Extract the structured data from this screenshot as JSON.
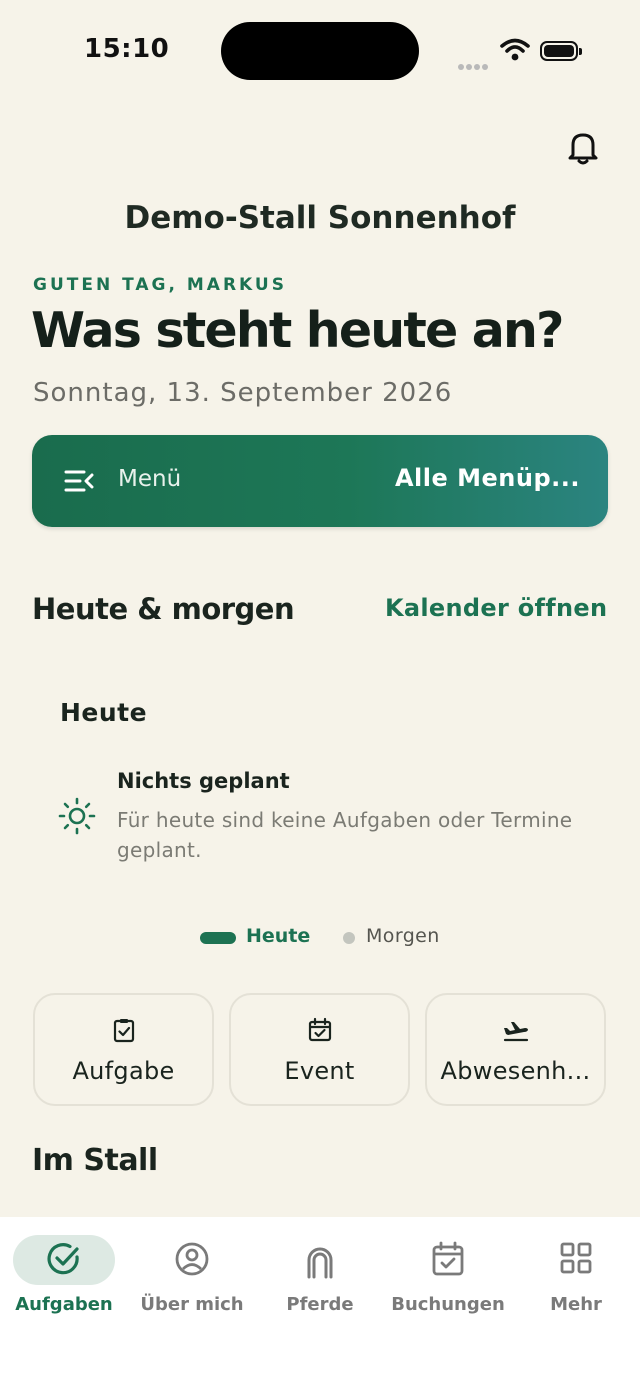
{
  "status_bar": {
    "time": "15:10"
  },
  "header": {
    "stable_name": "Demo-Stall Sonnenhof"
  },
  "greeting": "GUTEN TAG, MARKUS",
  "headline": "Was steht heute an?",
  "date": "Sonntag, 13. September 2026",
  "menu_banner": {
    "label": "Menü",
    "all_label": "Alle Menüp..."
  },
  "schedule": {
    "title": "Heute & morgen",
    "calendar_link": "Kalender öffnen",
    "day_title": "Heute",
    "empty_title": "Nichts geplant",
    "empty_desc": "Für heute sind keine Aufgaben oder Termine geplant.",
    "pager": {
      "active": "Heute",
      "inactive": "Morgen"
    }
  },
  "quick_actions": [
    {
      "label": "Aufgabe",
      "icon": "clipboard-check-icon"
    },
    {
      "label": "Event",
      "icon": "calendar-check-icon"
    },
    {
      "label": "Abwesenh...",
      "icon": "plane-departure-icon"
    }
  ],
  "stall_section": {
    "title": "Im Stall"
  },
  "tabs": [
    {
      "label": "Aufgaben",
      "icon": "check-circle-icon",
      "active": true
    },
    {
      "label": "Über mich",
      "icon": "user-circle-icon",
      "active": false
    },
    {
      "label": "Pferde",
      "icon": "horseshoe-icon",
      "active": false
    },
    {
      "label": "Buchungen",
      "icon": "calendar-check-icon",
      "active": false
    },
    {
      "label": "Mehr",
      "icon": "grid-icon",
      "active": false
    }
  ],
  "colors": {
    "accent": "#1c7252",
    "background": "#f6f3e9",
    "banner_end": "#2b8480"
  }
}
